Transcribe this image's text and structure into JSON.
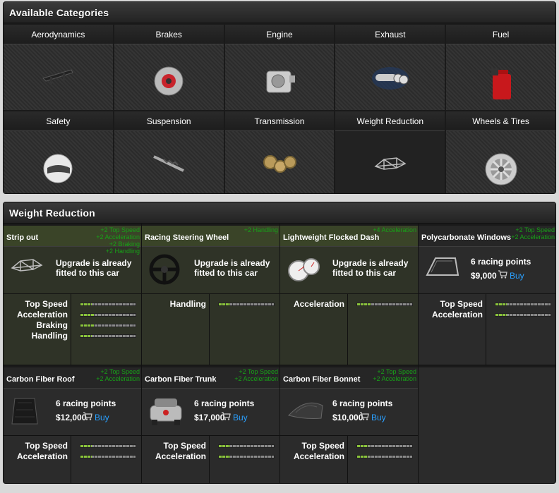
{
  "categories_panel": {
    "title": "Available Categories",
    "items": [
      {
        "label": "Aerodynamics",
        "icon": "spoiler-icon"
      },
      {
        "label": "Brakes",
        "icon": "brake-disc-icon"
      },
      {
        "label": "Engine",
        "icon": "engine-icon"
      },
      {
        "label": "Exhaust",
        "icon": "exhaust-icon"
      },
      {
        "label": "Fuel",
        "icon": "fuel-can-icon"
      },
      {
        "label": "Safety",
        "icon": "helmet-icon"
      },
      {
        "label": "Suspension",
        "icon": "shock-absorber-icon"
      },
      {
        "label": "Transmission",
        "icon": "gears-icon"
      },
      {
        "label": "Weight Reduction",
        "icon": "roll-cage-icon"
      },
      {
        "label": "Wheels & Tires",
        "icon": "wheel-icon"
      }
    ],
    "selected": "Weight Reduction"
  },
  "weight_panel": {
    "title": "Weight Reduction",
    "items": [
      {
        "name": "Strip out",
        "bonus": [
          "+2 Top Speed",
          "+2 Acceleration",
          "+2 Braking",
          "+2 Handling"
        ],
        "fitted": true,
        "status": "Upgrade is already fitted to this car",
        "stats": [
          {
            "name": "Top Speed",
            "value": 0.2
          },
          {
            "name": "Acceleration",
            "value": 0.25
          },
          {
            "name": "Braking",
            "value": 0.25
          },
          {
            "name": "Handling",
            "value": 0.2
          }
        ],
        "icon": "roll-cage-icon"
      },
      {
        "name": "Racing Steering Wheel",
        "bonus": [
          "+2 Handling"
        ],
        "fitted": true,
        "status": "Upgrade is already fitted to this car",
        "stats": [
          {
            "name": "Handling",
            "value": 0.2
          }
        ],
        "icon": "steering-wheel-icon"
      },
      {
        "name": "Lightweight Flocked Dash",
        "bonus": [
          "+4 Acceleration"
        ],
        "fitted": true,
        "status": "Upgrade is already fitted to this car",
        "stats": [
          {
            "name": "Acceleration",
            "value": 0.25
          }
        ],
        "icon": "gauges-icon"
      },
      {
        "name": "Polycarbonate Windows",
        "bonus": [
          "+2 Top Speed",
          "+2 Acceleration"
        ],
        "fitted": false,
        "points": "6 racing points",
        "price": "$9,000",
        "buy": "Buy",
        "stats": [
          {
            "name": "Top Speed",
            "value": 0.2
          },
          {
            "name": "Acceleration",
            "value": 0.2
          }
        ],
        "icon": "window-icon"
      },
      {
        "name": "Carbon Fiber Roof",
        "bonus": [
          "+2 Top Speed",
          "+2 Acceleration"
        ],
        "fitted": false,
        "points": "6 racing points",
        "price": "$12,000",
        "buy": "Buy",
        "stats": [
          {
            "name": "Top Speed",
            "value": 0.2
          },
          {
            "name": "Acceleration",
            "value": 0.2
          }
        ],
        "icon": "carbon-roof-icon"
      },
      {
        "name": "Carbon Fiber Trunk",
        "bonus": [
          "+2 Top Speed",
          "+2 Acceleration"
        ],
        "fitted": false,
        "points": "6 racing points",
        "price": "$17,000",
        "buy": "Buy",
        "stats": [
          {
            "name": "Top Speed",
            "value": 0.2
          },
          {
            "name": "Acceleration",
            "value": 0.2
          }
        ],
        "icon": "car-rear-icon"
      },
      {
        "name": "Carbon Fiber Bonnet",
        "bonus": [
          "+2 Top Speed",
          "+2 Acceleration"
        ],
        "fitted": false,
        "points": "6 racing points",
        "price": "$10,000",
        "buy": "Buy",
        "stats": [
          {
            "name": "Top Speed",
            "value": 0.2
          },
          {
            "name": "Acceleration",
            "value": 0.2
          }
        ],
        "icon": "carbon-bonnet-icon"
      }
    ]
  },
  "colors": {
    "bonus_text": "#18a018",
    "buy_link": "#2aa0ff",
    "bar_fill": "#8ac43a"
  }
}
